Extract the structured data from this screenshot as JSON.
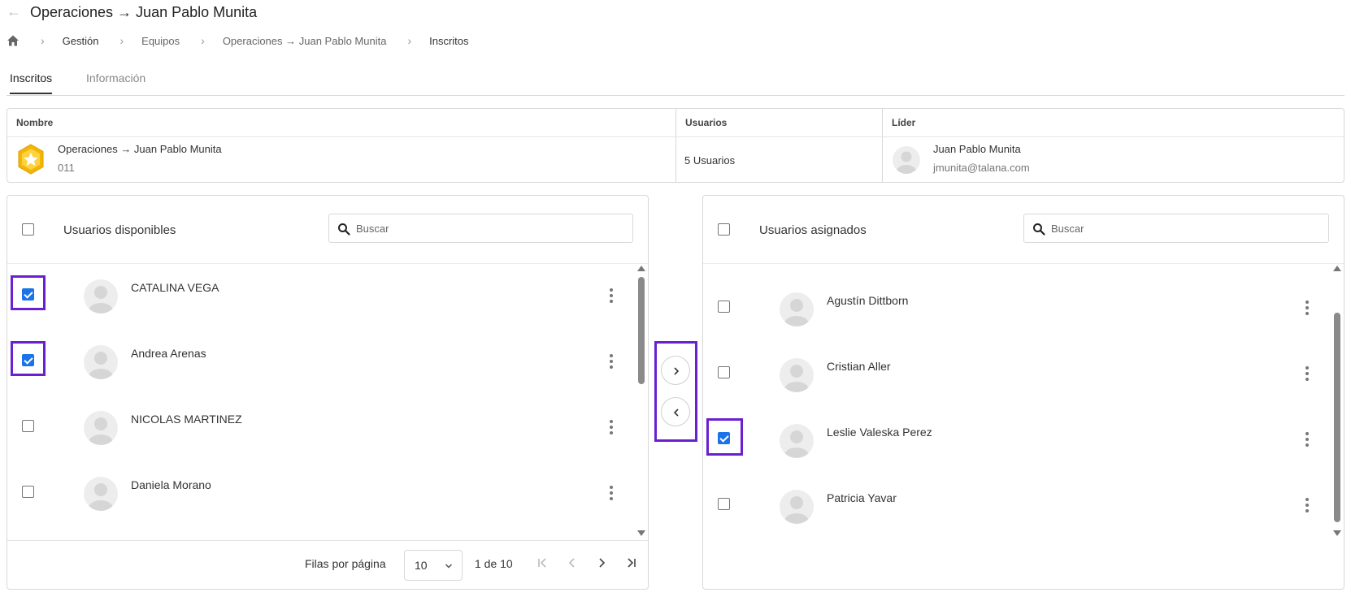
{
  "header": {
    "title": "Operaciones → Juan Pablo Munita",
    "back_glyph": "←"
  },
  "breadcrumb": {
    "items": [
      "Gestión",
      "Equipos",
      "Operaciones → Juan Pablo Munita",
      "Inscritos"
    ],
    "separator": "›"
  },
  "tabs": [
    {
      "label": "Inscritos",
      "active": true
    },
    {
      "label": "Información",
      "active": false
    }
  ],
  "team_table": {
    "headers": {
      "name": "Nombre",
      "users": "Usuarios",
      "leader": "Líder"
    },
    "row": {
      "name": "Operaciones → Juan Pablo Munita",
      "code": "011",
      "users": "5 Usuarios",
      "leader_name": "Juan Pablo Munita",
      "leader_email": "jmunita@talana.com"
    }
  },
  "available_panel": {
    "title": "Usuarios disponibles",
    "search_placeholder": "Buscar",
    "select_all_checked": false,
    "users": [
      {
        "name": "CATALINA VEGA",
        "checked": true
      },
      {
        "name": "Andrea Arenas",
        "checked": true
      },
      {
        "name": "NICOLAS MARTINEZ",
        "checked": false
      },
      {
        "name": "Daniela Morano",
        "checked": false
      }
    ],
    "footer": {
      "rows_per_page_label": "Filas por página",
      "rows_per_page_value": "10",
      "page_info": "1 de 10"
    }
  },
  "assigned_panel": {
    "title": "Usuarios asignados",
    "search_placeholder": "Buscar",
    "select_all_checked": false,
    "users": [
      {
        "name": "Agustín Dittborn",
        "checked": false
      },
      {
        "name": "Cristian Aller",
        "checked": false
      },
      {
        "name": "Leslie Valeska Perez",
        "checked": true
      },
      {
        "name": "Patricia Yavar",
        "checked": false
      }
    ]
  },
  "colors": {
    "accent": "#1a73e8",
    "highlight": "#6a1fd1",
    "border": "#d8d8d8",
    "badge_gold": "#f2b705"
  },
  "icons": {
    "back": "arrow-left-icon",
    "home": "home-icon",
    "search": "search-icon",
    "more": "kebab-menu-icon",
    "move_right": "chevron-right-icon",
    "move_left": "chevron-left-icon",
    "team_badge": "star-badge-icon"
  }
}
